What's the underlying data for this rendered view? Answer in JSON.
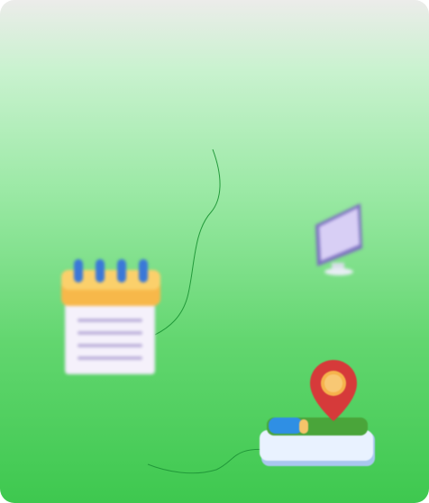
{
  "scene": {
    "background_colors": [
      "#ececea",
      "#9be9a5",
      "#3ec84f"
    ],
    "line_color": "#22993a",
    "icons": [
      {
        "id": "notepad",
        "icon": "spiral-notepad-icon"
      },
      {
        "id": "monitor",
        "icon": "desktop-monitor-icon"
      },
      {
        "id": "map",
        "icon": "map-location-pin-icon"
      }
    ]
  }
}
